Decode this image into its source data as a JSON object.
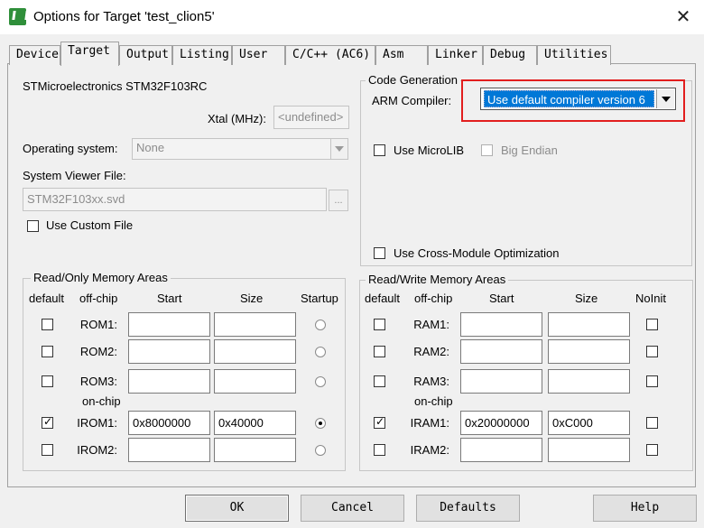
{
  "window": {
    "title": "Options for Target 'test_clion5'"
  },
  "tabs": [
    "Device",
    "Target",
    "Output",
    "Listing",
    "User",
    "C/C++ (AC6)",
    "Asm",
    "Linker",
    "Debug",
    "Utilities"
  ],
  "active_tab": "Target",
  "device": {
    "name": "STMicroelectronics STM32F103RC"
  },
  "xtal": {
    "label": "Xtal (MHz):",
    "value": "<undefined>"
  },
  "os": {
    "label": "Operating system:",
    "value": "None"
  },
  "svd": {
    "label": "System Viewer File:",
    "value": "STM32F103xx.svd",
    "browse": "...",
    "custom_label": "Use Custom File"
  },
  "codegen": {
    "title": "Code Generation",
    "compiler_label": "ARM Compiler:",
    "compiler_value": "Use default compiler version 6",
    "microlib": "Use MicroLIB",
    "big_endian": "Big Endian",
    "cross_module": "Use Cross-Module Optimization"
  },
  "ro": {
    "title": "Read/Only Memory Areas",
    "headers": {
      "default": "default",
      "offchip": "off-chip",
      "start": "Start",
      "size": "Size",
      "extra": "Startup"
    },
    "onchip_label": "on-chip",
    "rows": [
      {
        "label": "ROM1:",
        "start": "",
        "size": "",
        "default": false,
        "extra": false
      },
      {
        "label": "ROM2:",
        "start": "",
        "size": "",
        "default": false,
        "extra": false
      },
      {
        "label": "ROM3:",
        "start": "",
        "size": "",
        "default": false,
        "extra": false
      },
      {
        "label": "IROM1:",
        "start": "0x8000000",
        "size": "0x40000",
        "default": true,
        "extra": true
      },
      {
        "label": "IROM2:",
        "start": "",
        "size": "",
        "default": false,
        "extra": false
      }
    ]
  },
  "rw": {
    "title": "Read/Write Memory Areas",
    "headers": {
      "default": "default",
      "offchip": "off-chip",
      "start": "Start",
      "size": "Size",
      "extra": "NoInit"
    },
    "onchip_label": "on-chip",
    "rows": [
      {
        "label": "RAM1:",
        "start": "",
        "size": "",
        "default": false,
        "extra": false
      },
      {
        "label": "RAM2:",
        "start": "",
        "size": "",
        "default": false,
        "extra": false
      },
      {
        "label": "RAM3:",
        "start": "",
        "size": "",
        "default": false,
        "extra": false
      },
      {
        "label": "IRAM1:",
        "start": "0x20000000",
        "size": "0xC000",
        "default": true,
        "extra": false
      },
      {
        "label": "IRAM2:",
        "start": "",
        "size": "",
        "default": false,
        "extra": false
      }
    ]
  },
  "buttons": {
    "ok": "OK",
    "cancel": "Cancel",
    "defaults": "Defaults",
    "help": "Help"
  },
  "colors": {
    "highlight": "#0078d7",
    "annotation": "#e21e1e"
  }
}
